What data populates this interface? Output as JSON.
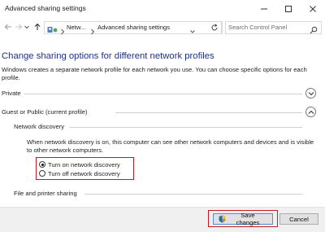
{
  "window": {
    "title": "Advanced sharing settings"
  },
  "address_bar": {
    "crumbs": [
      "Netw...",
      "Advanced sharing settings"
    ],
    "search_placeholder": "Search Control Panel"
  },
  "main": {
    "heading": "Change sharing options for different network profiles",
    "description": "Windows creates a separate network profile for each network you use. You can choose specific options for each profile.",
    "profiles": [
      {
        "label": "Private",
        "expanded": false
      },
      {
        "label": "Guest or Public (current profile)",
        "expanded": true
      }
    ],
    "network_discovery": {
      "label": "Network discovery",
      "description": "When network discovery is on, this computer can see other network computers and devices and is visible to other network computers.",
      "options": [
        {
          "label": "Turn on network discovery",
          "checked": true
        },
        {
          "label": "Turn off network discovery",
          "checked": false
        }
      ]
    },
    "file_printer_sharing": {
      "label": "File and printer sharing"
    }
  },
  "footer": {
    "save_label": "Save changes",
    "cancel_label": "Cancel"
  },
  "colors": {
    "heading": "#1e3287",
    "highlight": "#c9181f"
  }
}
